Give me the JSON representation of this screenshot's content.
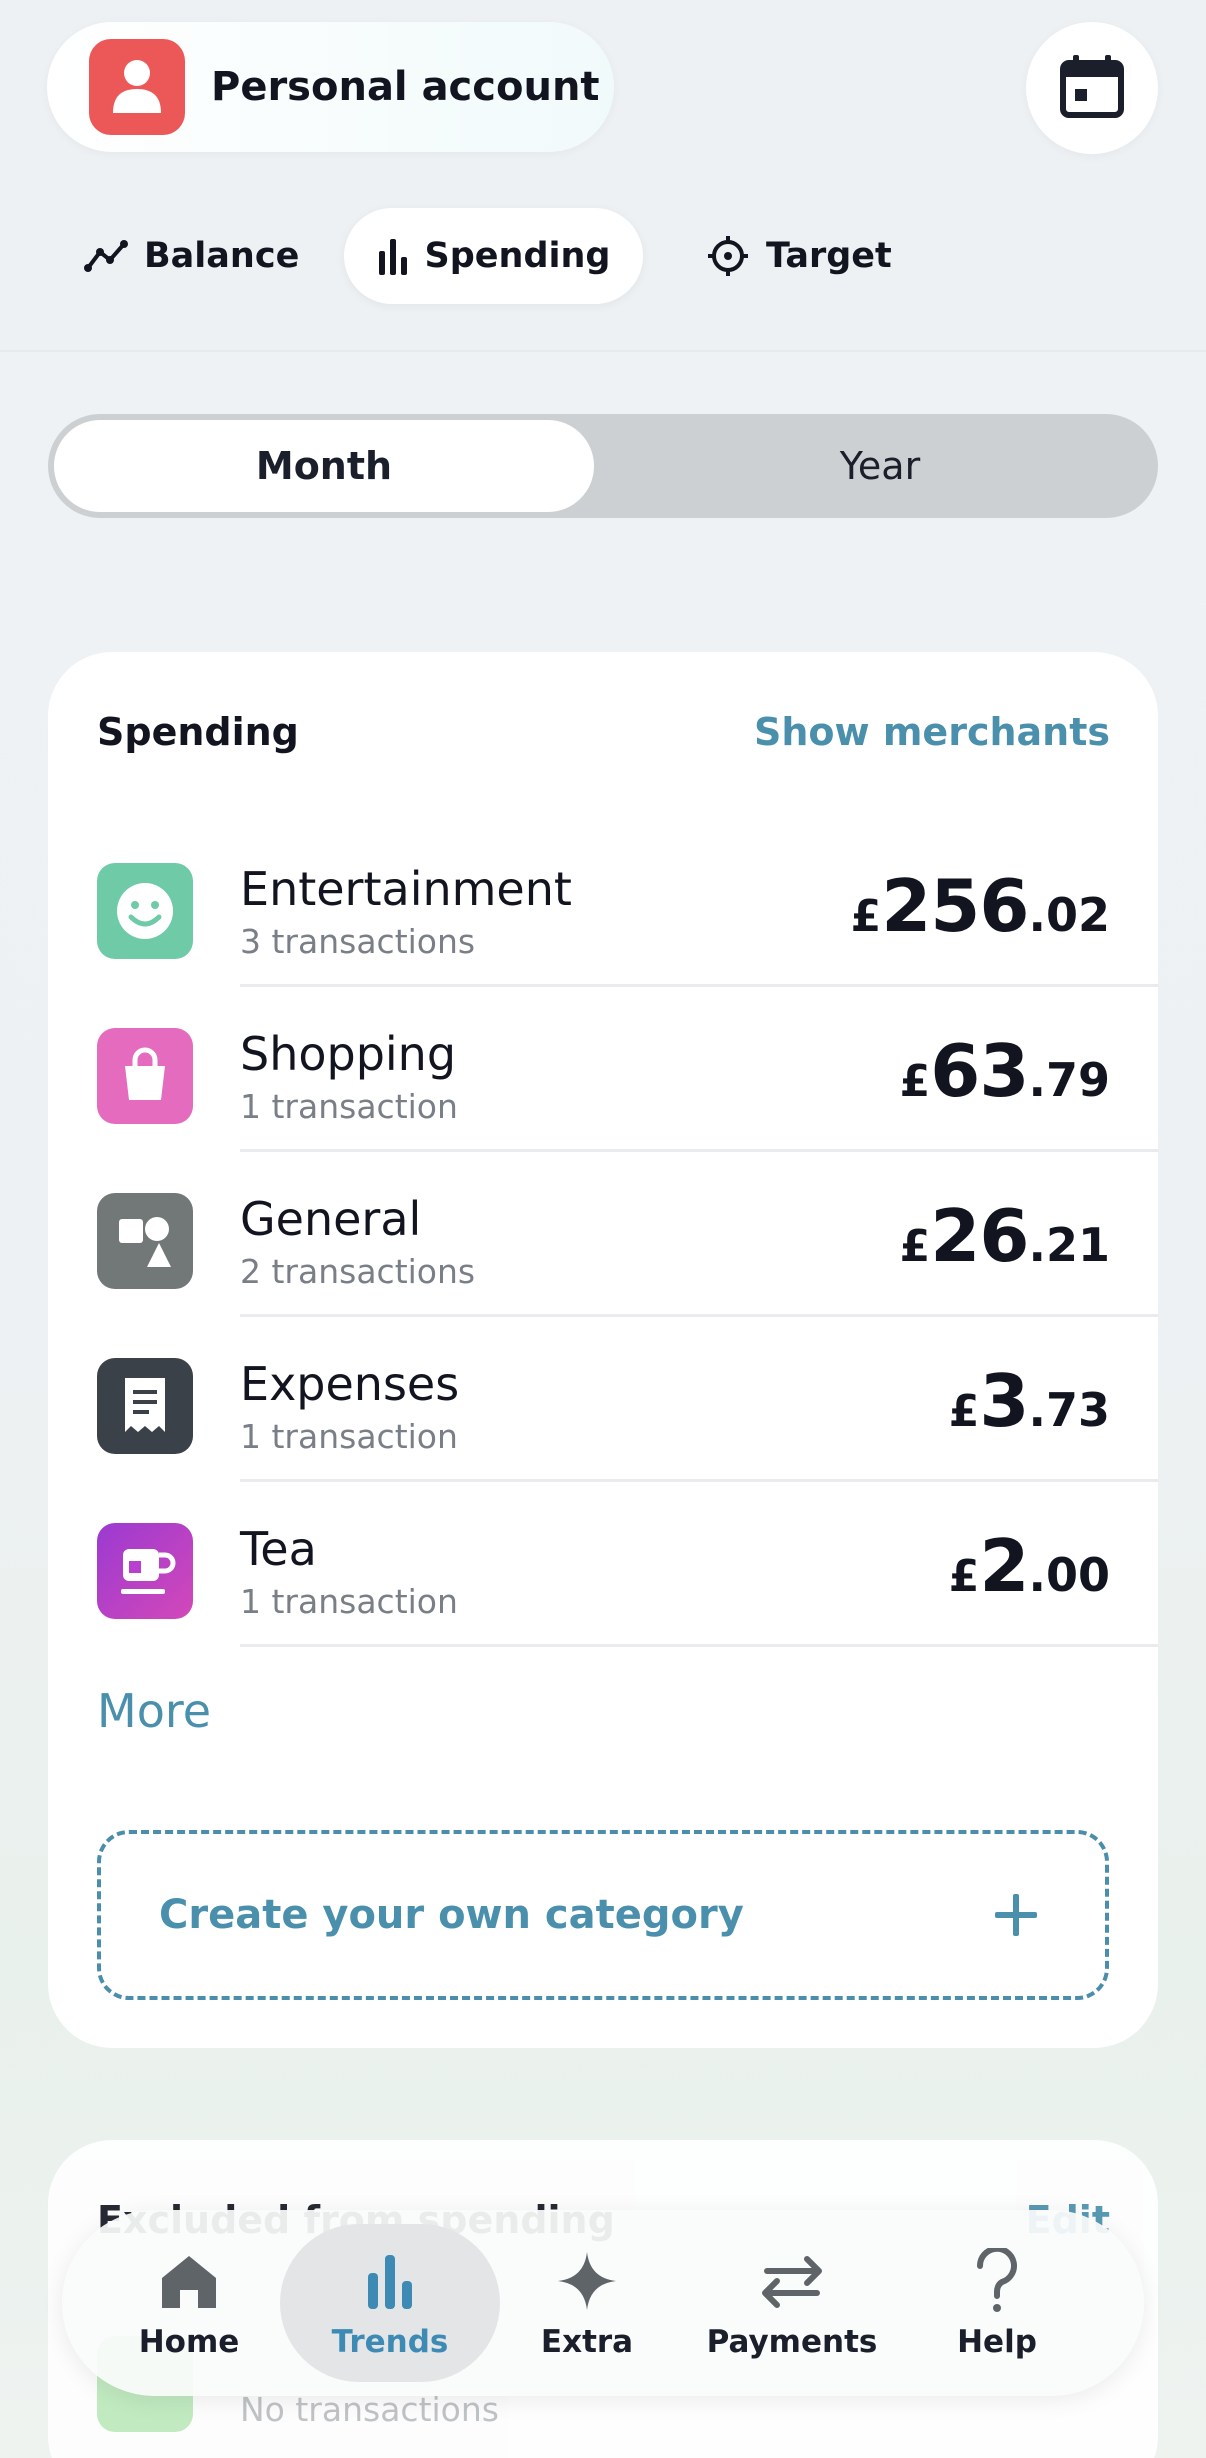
{
  "account": {
    "label": "Personal account",
    "avatar_icon": "person-icon",
    "avatar_color": "#ec5858"
  },
  "header": {
    "calendar_icon": "calendar-icon"
  },
  "tabs": [
    {
      "label": "Balance",
      "icon": "line-chart-icon"
    },
    {
      "label": "Spending",
      "icon": "bar-chart-icon",
      "selected": true
    },
    {
      "label": "Target",
      "icon": "target-icon"
    }
  ],
  "period": {
    "month": "Month",
    "year": "Year",
    "selected": "Month"
  },
  "spending": {
    "title": "Spending",
    "show_merchants": "Show merchants",
    "categories": [
      {
        "name": "Entertainment",
        "sub": "3 transactions",
        "currency": "£",
        "int": "256",
        "dec": ".02",
        "color": "#6fcaa8",
        "icon": "smiley-icon"
      },
      {
        "name": "Shopping",
        "sub": "1 transaction",
        "currency": "£",
        "int": "63",
        "dec": ".79",
        "color": "#e46bbd",
        "icon": "shopping-bag-icon"
      },
      {
        "name": "General",
        "sub": "2 transactions",
        "currency": "£",
        "int": "26",
        "dec": ".21",
        "color": "#727777",
        "icon": "shapes-icon"
      },
      {
        "name": "Expenses",
        "sub": "1 transaction",
        "currency": "£",
        "int": "3",
        "dec": ".73",
        "color": "#3a4148",
        "icon": "receipt-icon"
      },
      {
        "name": "Tea",
        "sub": "1 transaction",
        "currency": "£",
        "int": "2",
        "dec": ".00",
        "color": "#b83fcf",
        "icon": "tea-cup-icon"
      }
    ],
    "more": "More",
    "create_category": "Create your own category"
  },
  "excluded": {
    "title": "Excluded from spending",
    "edit": "Edit",
    "sub": "No transactions"
  },
  "nav": [
    {
      "label": "Home",
      "icon": "home-icon"
    },
    {
      "label": "Trends",
      "icon": "trends-icon",
      "selected": true
    },
    {
      "label": "Extra",
      "icon": "sparkle-icon"
    },
    {
      "label": "Payments",
      "icon": "transfer-arrows-icon"
    },
    {
      "label": "Help",
      "icon": "question-icon"
    }
  ],
  "colors": {
    "accent": "#4a90ad",
    "nav_selected": "#3d8bb4"
  }
}
